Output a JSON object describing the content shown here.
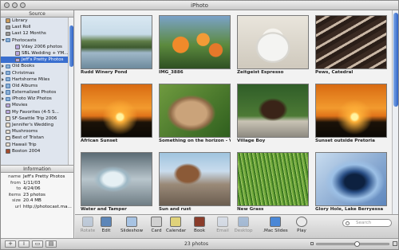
{
  "window": {
    "title": "iPhoto"
  },
  "sidebar": {
    "header": "Source",
    "items": [
      {
        "label": "Library",
        "icon": "library-icon",
        "indent": 0,
        "state": ""
      },
      {
        "label": "Last Roll",
        "icon": "film-roll-icon",
        "indent": 0,
        "state": ""
      },
      {
        "label": "Last 12 Months",
        "icon": "calendar-icon",
        "indent": 0,
        "state": ""
      },
      {
        "label": "Photocasts",
        "icon": "folder-icon",
        "indent": 0,
        "state": "open"
      },
      {
        "label": "Vday 2006 photos",
        "icon": "photocast-icon",
        "indent": 1,
        "state": ""
      },
      {
        "label": "SBL Wedding + YM...",
        "icon": "photocast-icon",
        "indent": 1,
        "state": ""
      },
      {
        "label": "Jeff's Pretty Photos",
        "icon": "photocast-icon",
        "indent": 1,
        "state": "selected"
      },
      {
        "label": "Old Books",
        "icon": "folder-icon",
        "indent": 0,
        "state": "closed"
      },
      {
        "label": "Christmas",
        "icon": "folder-icon",
        "indent": 0,
        "state": "closed"
      },
      {
        "label": "Hartshorne Miles",
        "icon": "folder-icon",
        "indent": 0,
        "state": "closed"
      },
      {
        "label": "Old Albums",
        "icon": "folder-icon",
        "indent": 0,
        "state": "closed"
      },
      {
        "label": "Externalized Photos",
        "icon": "folder-icon",
        "indent": 0,
        "state": "closed"
      },
      {
        "label": "iPhoto Wiz Photos",
        "icon": "folder-icon",
        "indent": 0,
        "state": "closed"
      },
      {
        "label": "Movies",
        "icon": "smart-album-icon",
        "indent": 0,
        "state": ""
      },
      {
        "label": "My Favorites (4-5 S...",
        "icon": "smart-album-icon",
        "indent": 0,
        "state": ""
      },
      {
        "label": "SF-Seattle Trip 2006",
        "icon": "album-icon",
        "indent": 0,
        "state": ""
      },
      {
        "label": "Jennifer's Wedding",
        "icon": "album-icon",
        "indent": 0,
        "state": ""
      },
      {
        "label": "Mushrooms",
        "icon": "album-icon",
        "indent": 0,
        "state": ""
      },
      {
        "label": "Best of Tristan",
        "icon": "album-icon",
        "indent": 0,
        "state": ""
      },
      {
        "label": "Hawaii Trip",
        "icon": "album-icon",
        "indent": 0,
        "state": ""
      },
      {
        "label": "Boston 2004",
        "icon": "book-icon",
        "indent": 0,
        "state": ""
      }
    ]
  },
  "info": {
    "header": "Information",
    "rows": [
      {
        "key": "name",
        "value": "Jeff's Pretty Photos"
      },
      {
        "key": "from",
        "value": "1/11/03"
      },
      {
        "key": "to",
        "value": "4/24/06"
      },
      {
        "key": "items",
        "value": "23 photos"
      },
      {
        "key": "size",
        "value": "20.4 MB"
      },
      {
        "key": "url",
        "value": "http://photocast.ma..."
      }
    ]
  },
  "photos": [
    {
      "caption": "Rudd Winery Pond",
      "icon": "pond-photo"
    },
    {
      "caption": "IMG_3886",
      "icon": "tulips-photo"
    },
    {
      "caption": "Zeitgeist Espresso",
      "icon": "espresso-photo"
    },
    {
      "caption": "Pews, Catedral",
      "icon": "pews-photo"
    },
    {
      "caption": "African Sunset",
      "icon": "sunset-photo"
    },
    {
      "caption": "Something on the horizon - Vervi...",
      "icon": "lioness-photo"
    },
    {
      "caption": "Village Boy",
      "icon": "boy-photo"
    },
    {
      "caption": "Sunset outside Pretoria",
      "icon": "sunset-photo"
    },
    {
      "caption": "Water and Tamper",
      "icon": "glass-photo"
    },
    {
      "caption": "Sun and rust",
      "icon": "valve-photo"
    },
    {
      "caption": "New Grass",
      "icon": "grass-photo"
    },
    {
      "caption": "Glory Hole, Lake Berryessa",
      "icon": "glory-hole-photo"
    }
  ],
  "toolbar": {
    "tools": [
      {
        "label": "Rotate",
        "icon": "rotate-icon",
        "enabled": false
      },
      {
        "label": "Edit",
        "icon": "edit-icon",
        "enabled": true
      },
      {
        "label": "Slideshow",
        "icon": "slideshow-icon",
        "enabled": true
      },
      {
        "label": "Card",
        "icon": "card-icon",
        "enabled": true
      },
      {
        "label": "Calendar",
        "icon": "calendar-icon",
        "enabled": true
      },
      {
        "label": "Book",
        "icon": "book-icon",
        "enabled": true
      },
      {
        "label": "Email",
        "icon": "email-icon",
        "enabled": false
      },
      {
        "label": "Desktop",
        "icon": "desktop-icon",
        "enabled": false
      },
      {
        "label": ".Mac Slides",
        "icon": "mac-slides-icon",
        "enabled": true
      },
      {
        "label": "Play",
        "icon": "play-icon",
        "enabled": true
      }
    ],
    "search_placeholder": "Search"
  },
  "status": {
    "count": "23 photos",
    "buttons": [
      "+",
      "i",
      "slideshow",
      "info"
    ],
    "zoom_level": 0.55
  },
  "colors": {
    "selection": "#3a6fcf",
    "accent": "#2c60c4"
  }
}
